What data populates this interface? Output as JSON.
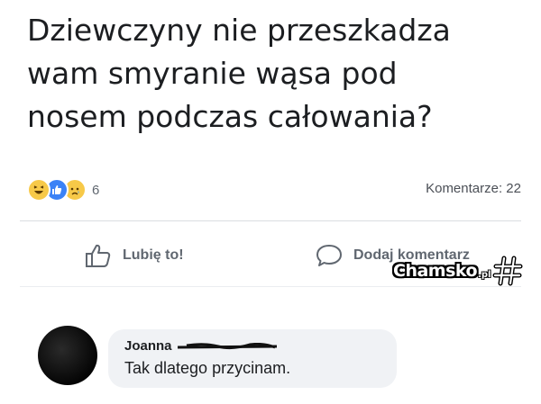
{
  "post": {
    "text": "Dziewczyny nie przeszkadza\nwam smyranie wąsa pod\nnosem podczas całowania?"
  },
  "reactions": {
    "icons": [
      "haha-reaction-icon",
      "like-reaction-icon",
      "sad-reaction-icon"
    ],
    "count": "6"
  },
  "comments_count_label": "Komentarze: 22",
  "actions": {
    "like_label": "Lubię to!",
    "comment_label": "Dodaj komentarz"
  },
  "comment": {
    "author": "Joanna",
    "text": "Tak dlatego przycinam."
  },
  "watermark": {
    "text": "Chamsko",
    "suffix": ".pl"
  },
  "colors": {
    "text": "#1c1e21",
    "muted": "#606770",
    "like_blue": "#3b82f6",
    "reaction_yellow": "#f7c948",
    "bubble": "#f0f2f5"
  }
}
